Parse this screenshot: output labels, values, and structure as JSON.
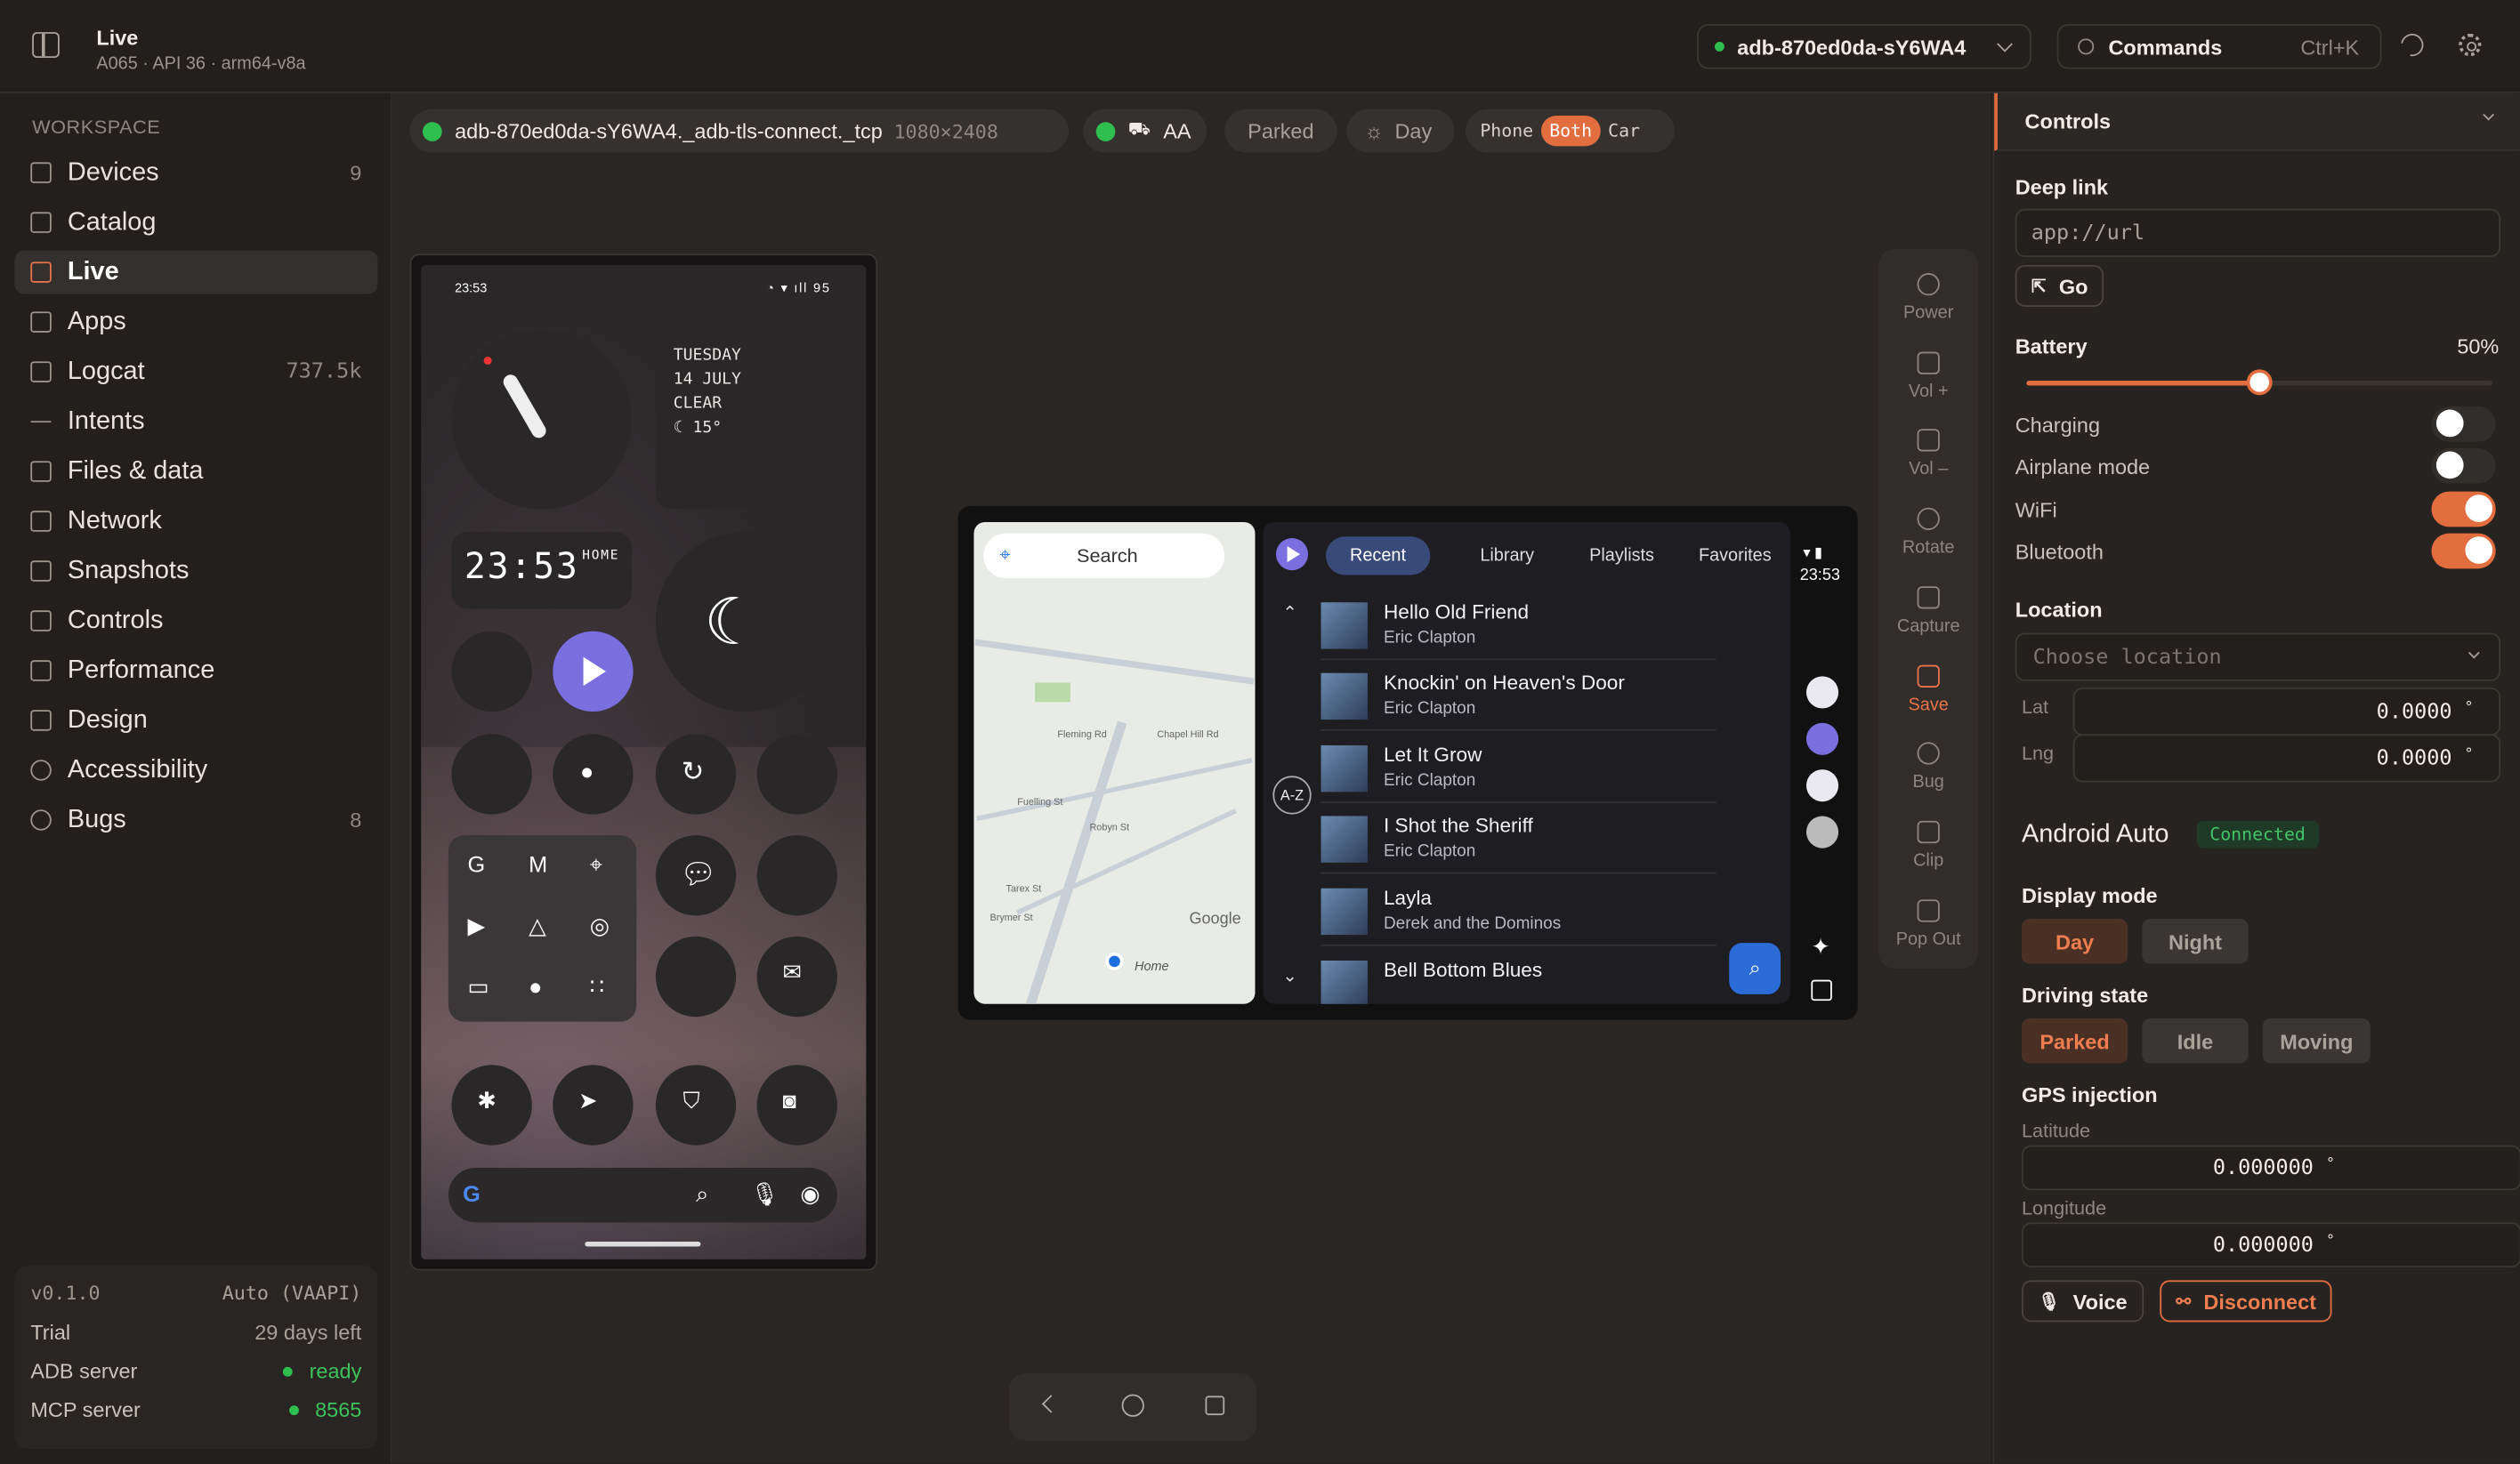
{
  "app": {
    "title": "Live",
    "subtitle": "A065 · API 36 · arm64-v8a"
  },
  "topbar": {
    "device": "adb-870ed0da-sY6WA4",
    "commands_placeholder": "Commands",
    "commands_shortcut": "Ctrl+K"
  },
  "sidebar": {
    "section": "WORKSPACE",
    "items": [
      {
        "label": "Devices",
        "count": "9",
        "icon": "devices-icon"
      },
      {
        "label": "Catalog",
        "count": "",
        "icon": "cube-icon"
      },
      {
        "label": "Live",
        "count": "",
        "icon": "live-icon",
        "active": true
      },
      {
        "label": "Apps",
        "count": "",
        "icon": "grid-icon"
      },
      {
        "label": "Logcat",
        "count": "737.5k",
        "icon": "document-icon"
      },
      {
        "label": "Intents",
        "count": "",
        "icon": "arrow-right-icon"
      },
      {
        "label": "Files & data",
        "count": "",
        "icon": "folder-icon"
      },
      {
        "label": "Network",
        "count": "",
        "icon": "network-icon"
      },
      {
        "label": "Snapshots",
        "count": "",
        "icon": "snapshot-icon"
      },
      {
        "label": "Controls",
        "count": "",
        "icon": "sliders-icon"
      },
      {
        "label": "Performance",
        "count": "",
        "icon": "chart-icon"
      },
      {
        "label": "Design",
        "count": "",
        "icon": "palette-icon"
      },
      {
        "label": "Accessibility",
        "count": "",
        "icon": "accessibility-icon"
      },
      {
        "label": "Bugs",
        "count": "8",
        "icon": "bug-icon"
      }
    ],
    "footer": {
      "version": "v0.1.0",
      "backend": "Auto (VAAPI)",
      "trial_label": "Trial",
      "trial_value": "29 days left",
      "adb_label": "ADB server",
      "adb_value": "ready",
      "mcp_label": "MCP server",
      "mcp_value": "8565"
    }
  },
  "toolbar": {
    "connection": "adb-870ed0da-sY6WA4._adb-tls-connect._tcp",
    "resolution": "1080×2408",
    "aa_label": "AA",
    "parked": "Parked",
    "day": "Day",
    "view_modes": [
      "Phone",
      "Both",
      "Car"
    ],
    "active_view": "Both"
  },
  "phone": {
    "status_time": "23:53",
    "status_battery": "95",
    "date_lines": [
      "TUESDAY",
      "14 JULY",
      "CLEAR",
      "☾ 15°"
    ],
    "big_time": "23:53",
    "big_time_tag": "HOME"
  },
  "car": {
    "search": "Search",
    "map_labels": [
      "Fleming Rd",
      "Robyn St",
      "Chapel Hill Rd",
      "Fuelling St",
      "Tarex St",
      "Brymer St",
      "Home",
      "Google"
    ],
    "tabs": [
      "Recent",
      "Library",
      "Playlists",
      "Favorites"
    ],
    "active_tab": "Recent",
    "songs": [
      {
        "title": "Hello Old Friend",
        "artist": "Eric Clapton"
      },
      {
        "title": "Knockin' on Heaven's Door",
        "artist": "Eric Clapton"
      },
      {
        "title": "Let It Grow",
        "artist": "Eric Clapton"
      },
      {
        "title": "I Shot the Sheriff",
        "artist": "Eric Clapton"
      },
      {
        "title": "Layla",
        "artist": "Derek and the Dominos"
      },
      {
        "title": "Bell Bottom Blues",
        "artist": ""
      }
    ],
    "az": "A-Z",
    "time": "23:53"
  },
  "side_controls": [
    "Power",
    "Vol +",
    "Vol –",
    "Rotate",
    "Capture",
    "Save",
    "Bug",
    "Clip",
    "Pop Out"
  ],
  "panel": {
    "title": "Controls",
    "deep_link_label": "Deep link",
    "deep_link_placeholder": "app://url",
    "go": "Go",
    "battery_label": "Battery",
    "battery_value": "50%",
    "battery_level": 0.5,
    "toggles": [
      {
        "label": "Charging",
        "on": false
      },
      {
        "label": "Airplane mode",
        "on": false
      },
      {
        "label": "WiFi",
        "on": true
      },
      {
        "label": "Bluetooth",
        "on": true
      }
    ],
    "location_label": "Location",
    "location_placeholder": "Choose location",
    "lat_label": "Lat",
    "lat_value": "0.0000",
    "lng_label": "Lng",
    "lng_value": "0.0000",
    "deg": "°",
    "aa_title": "Android Auto",
    "aa_status": "Connected",
    "display_mode_label": "Display mode",
    "display_modes": [
      "Day",
      "Night"
    ],
    "driving_label": "Driving state",
    "driving_states": [
      "Parked",
      "Idle",
      "Moving"
    ],
    "gps_label": "GPS injection",
    "latitude_label": "Latitude",
    "latitude_value": "0.000000",
    "longitude_label": "Longitude",
    "longitude_value": "0.000000",
    "voice": "Voice",
    "disconnect": "Disconnect"
  },
  "colors": {
    "accent": "#e26d3e",
    "ok": "#2fbf4f",
    "bg": "#221f1d"
  }
}
